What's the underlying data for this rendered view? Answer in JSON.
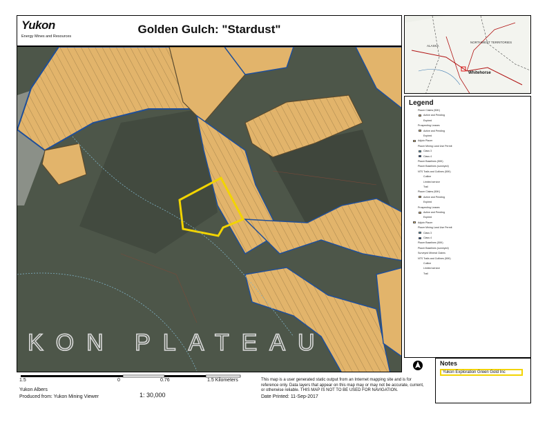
{
  "header": {
    "logo_text": "Yukon",
    "logo_subtext": "Energy Mines and Resources",
    "title": "Golden Gulch: \"Stardust\""
  },
  "map": {
    "area_label": "KON PLATEAU",
    "colors": {
      "claim_fill": "#e7b96a",
      "claim_outline": "#5a4a2e",
      "lease_outline": "#1f4f9a",
      "highlight": "#f2d400",
      "terrain": "#4b5447"
    }
  },
  "inset": {
    "labels": [
      "ALASKA",
      "NORTHWEST TERRITORIES",
      "Whitehorse"
    ]
  },
  "legend": {
    "heading": "Legend",
    "items": [
      "Placer Claims (50K)",
      "Active and Pending",
      "Expired",
      "Prospecting Leases",
      "Active and Pending",
      "Expired",
      "Adjoin Placer",
      "Placer Mining Land Use Permit",
      "Class 3",
      "Class 4",
      "Placer Baselines (50K)",
      "Placer Baselines (surveyed)",
      "NTS Trails and Cutlines (50K)",
      "Cutline",
      "Limited service",
      "Trail",
      "Placer Claims (50K)",
      "Active and Pending",
      "Expired",
      "Prospecting Leases",
      "Active and Pending",
      "Expired",
      "Adjoin Placer",
      "Placer Mining Land Use Permit",
      "Class 3",
      "Class 4",
      "Placer Baselines (50K)",
      "Placer Baselines (surveyed)",
      "Surveyed Mineral Claims",
      "NTS Trails and Cutlines (50K)",
      "Cutline",
      "Limited service",
      "Trail"
    ]
  },
  "notes": {
    "heading": "Notes",
    "text": "Yukon Exploration Green Gold Inc"
  },
  "footer": {
    "scale_left": "1.5",
    "scale_zero": "0",
    "scale_mid": "0.76",
    "scale_right": "1.5 Kilometers",
    "projection": "Yukon Albers",
    "produced": "Produced from: Yukon Mining Viewer",
    "ratio": "1:  30,000",
    "disclaimer": "This map is a user generated static output from an Internet mapping site and is for reference only. Data layers that appear on this map may or may not be accurate, current, or otherwise reliable. THIS MAP IS NOT TO BE USED FOR NAVIGATION.",
    "date_label": "Date Printed:",
    "date_value": "11-Sep-2017"
  }
}
